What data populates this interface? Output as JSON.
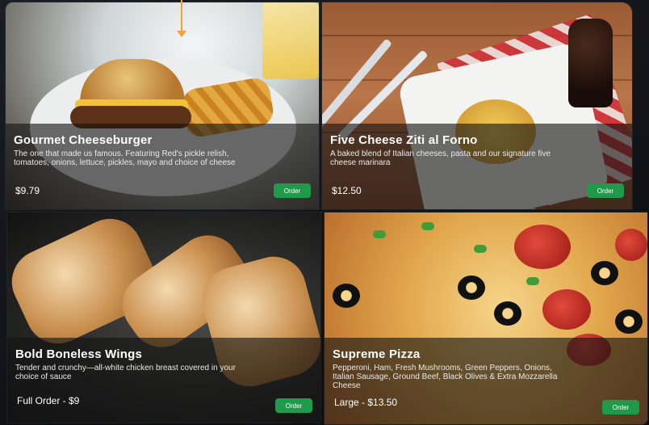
{
  "menu": {
    "items": [
      {
        "title": "Gourmet Cheeseburger",
        "description": "The one that made us famous. Featuring Red's pickle relish, tomatoes, onions, lettuce, pickles, mayo and choice of cheese",
        "price": "$9.79",
        "order_label": "Order"
      },
      {
        "title": "Five Cheese Ziti al Forno",
        "description": "A baked blend of Italian cheeses, pasta and our signature five cheese marinara",
        "price": "$12.50",
        "order_label": "Order"
      },
      {
        "title": "Bold Boneless Wings",
        "description": "Tender and crunchy—all-white chicken breast covered in your choice of sauce",
        "price": "Full Order - $9",
        "order_label": "Order"
      },
      {
        "title": "Supreme Pizza",
        "description": "Pepperoni, Ham, Fresh Mushrooms, Green Peppers, Onions, Italian Sausage, Ground Beef, Black Olives & Extra Mozzarella Cheese",
        "price": "Large - $13.50",
        "order_label": "Order"
      }
    ]
  },
  "colors": {
    "order_button": "#1f9a4a",
    "overlay": "rgba(20,20,20,0.62)",
    "pointer_arrow": "#f5a03a"
  },
  "icons": {
    "pointer": "arrow-down-icon"
  }
}
